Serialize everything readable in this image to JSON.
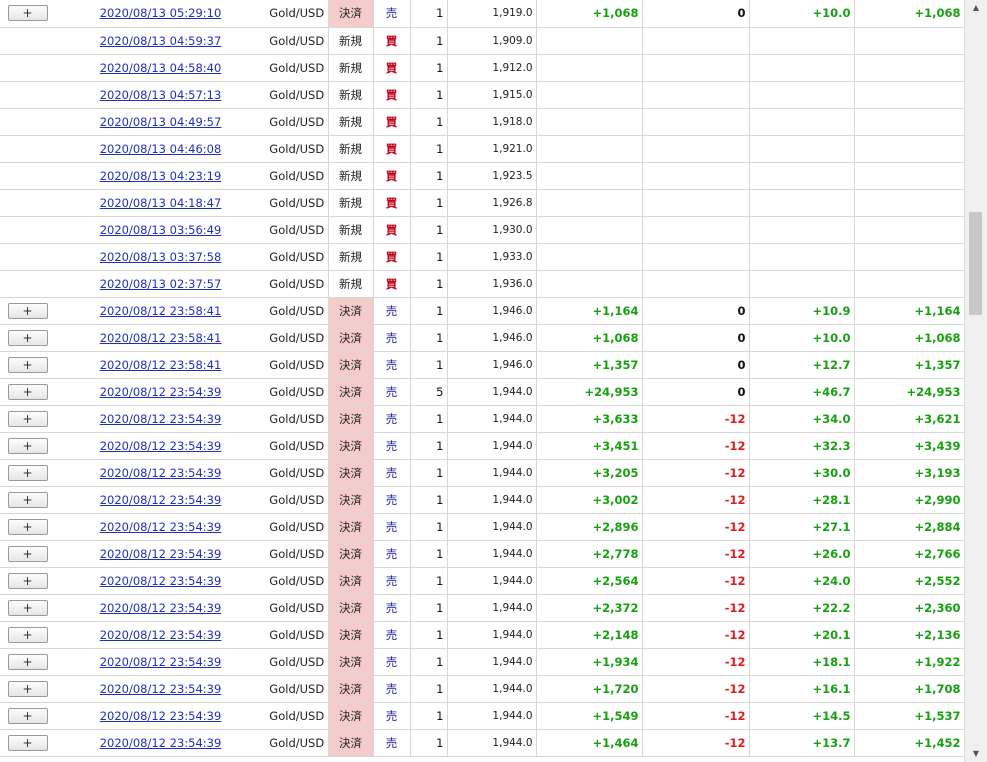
{
  "rows": [
    {
      "btn": "+",
      "time": "2020/08/13 05:29:10",
      "symbol": "Gold/USD",
      "kind": "決済",
      "side": "売",
      "qty": "1",
      "price": "1,919.0",
      "pl": "+1,068",
      "swap": "0",
      "pips": "+10.0",
      "total": "+1,068"
    },
    {
      "btn": "",
      "time": "2020/08/13 04:59:37",
      "symbol": "Gold/USD",
      "kind": "新規",
      "side": "買",
      "qty": "1",
      "price": "1,909.0",
      "pl": "",
      "swap": "",
      "pips": "",
      "total": ""
    },
    {
      "btn": "",
      "time": "2020/08/13 04:58:40",
      "symbol": "Gold/USD",
      "kind": "新規",
      "side": "買",
      "qty": "1",
      "price": "1,912.0",
      "pl": "",
      "swap": "",
      "pips": "",
      "total": ""
    },
    {
      "btn": "",
      "time": "2020/08/13 04:57:13",
      "symbol": "Gold/USD",
      "kind": "新規",
      "side": "買",
      "qty": "1",
      "price": "1,915.0",
      "pl": "",
      "swap": "",
      "pips": "",
      "total": ""
    },
    {
      "btn": "",
      "time": "2020/08/13 04:49:57",
      "symbol": "Gold/USD",
      "kind": "新規",
      "side": "買",
      "qty": "1",
      "price": "1,918.0",
      "pl": "",
      "swap": "",
      "pips": "",
      "total": ""
    },
    {
      "btn": "",
      "time": "2020/08/13 04:46:08",
      "symbol": "Gold/USD",
      "kind": "新規",
      "side": "買",
      "qty": "1",
      "price": "1,921.0",
      "pl": "",
      "swap": "",
      "pips": "",
      "total": ""
    },
    {
      "btn": "",
      "time": "2020/08/13 04:23:19",
      "symbol": "Gold/USD",
      "kind": "新規",
      "side": "買",
      "qty": "1",
      "price": "1,923.5",
      "pl": "",
      "swap": "",
      "pips": "",
      "total": ""
    },
    {
      "btn": "",
      "time": "2020/08/13 04:18:47",
      "symbol": "Gold/USD",
      "kind": "新規",
      "side": "買",
      "qty": "1",
      "price": "1,926.8",
      "pl": "",
      "swap": "",
      "pips": "",
      "total": ""
    },
    {
      "btn": "",
      "time": "2020/08/13 03:56:49",
      "symbol": "Gold/USD",
      "kind": "新規",
      "side": "買",
      "qty": "1",
      "price": "1,930.0",
      "pl": "",
      "swap": "",
      "pips": "",
      "total": ""
    },
    {
      "btn": "",
      "time": "2020/08/13 03:37:58",
      "symbol": "Gold/USD",
      "kind": "新規",
      "side": "買",
      "qty": "1",
      "price": "1,933.0",
      "pl": "",
      "swap": "",
      "pips": "",
      "total": ""
    },
    {
      "btn": "",
      "time": "2020/08/13 02:37:57",
      "symbol": "Gold/USD",
      "kind": "新規",
      "side": "買",
      "qty": "1",
      "price": "1,936.0",
      "pl": "",
      "swap": "",
      "pips": "",
      "total": ""
    },
    {
      "btn": "+",
      "time": "2020/08/12 23:58:41",
      "symbol": "Gold/USD",
      "kind": "決済",
      "side": "売",
      "qty": "1",
      "price": "1,946.0",
      "pl": "+1,164",
      "swap": "0",
      "pips": "+10.9",
      "total": "+1,164"
    },
    {
      "btn": "+",
      "time": "2020/08/12 23:58:41",
      "symbol": "Gold/USD",
      "kind": "決済",
      "side": "売",
      "qty": "1",
      "price": "1,946.0",
      "pl": "+1,068",
      "swap": "0",
      "pips": "+10.0",
      "total": "+1,068"
    },
    {
      "btn": "+",
      "time": "2020/08/12 23:58:41",
      "symbol": "Gold/USD",
      "kind": "決済",
      "side": "売",
      "qty": "1",
      "price": "1,946.0",
      "pl": "+1,357",
      "swap": "0",
      "pips": "+12.7",
      "total": "+1,357"
    },
    {
      "btn": "+",
      "time": "2020/08/12 23:54:39",
      "symbol": "Gold/USD",
      "kind": "決済",
      "side": "売",
      "qty": "5",
      "price": "1,944.0",
      "pl": "+24,953",
      "swap": "0",
      "pips": "+46.7",
      "total": "+24,953"
    },
    {
      "btn": "+",
      "time": "2020/08/12 23:54:39",
      "symbol": "Gold/USD",
      "kind": "決済",
      "side": "売",
      "qty": "1",
      "price": "1,944.0",
      "pl": "+3,633",
      "swap": "-12",
      "pips": "+34.0",
      "total": "+3,621"
    },
    {
      "btn": "+",
      "time": "2020/08/12 23:54:39",
      "symbol": "Gold/USD",
      "kind": "決済",
      "side": "売",
      "qty": "1",
      "price": "1,944.0",
      "pl": "+3,451",
      "swap": "-12",
      "pips": "+32.3",
      "total": "+3,439"
    },
    {
      "btn": "+",
      "time": "2020/08/12 23:54:39",
      "symbol": "Gold/USD",
      "kind": "決済",
      "side": "売",
      "qty": "1",
      "price": "1,944.0",
      "pl": "+3,205",
      "swap": "-12",
      "pips": "+30.0",
      "total": "+3,193"
    },
    {
      "btn": "+",
      "time": "2020/08/12 23:54:39",
      "symbol": "Gold/USD",
      "kind": "決済",
      "side": "売",
      "qty": "1",
      "price": "1,944.0",
      "pl": "+3,002",
      "swap": "-12",
      "pips": "+28.1",
      "total": "+2,990"
    },
    {
      "btn": "+",
      "time": "2020/08/12 23:54:39",
      "symbol": "Gold/USD",
      "kind": "決済",
      "side": "売",
      "qty": "1",
      "price": "1,944.0",
      "pl": "+2,896",
      "swap": "-12",
      "pips": "+27.1",
      "total": "+2,884"
    },
    {
      "btn": "+",
      "time": "2020/08/12 23:54:39",
      "symbol": "Gold/USD",
      "kind": "決済",
      "side": "売",
      "qty": "1",
      "price": "1,944.0",
      "pl": "+2,778",
      "swap": "-12",
      "pips": "+26.0",
      "total": "+2,766"
    },
    {
      "btn": "+",
      "time": "2020/08/12 23:54:39",
      "symbol": "Gold/USD",
      "kind": "決済",
      "side": "売",
      "qty": "1",
      "price": "1,944.0",
      "pl": "+2,564",
      "swap": "-12",
      "pips": "+24.0",
      "total": "+2,552"
    },
    {
      "btn": "+",
      "time": "2020/08/12 23:54:39",
      "symbol": "Gold/USD",
      "kind": "決済",
      "side": "売",
      "qty": "1",
      "price": "1,944.0",
      "pl": "+2,372",
      "swap": "-12",
      "pips": "+22.2",
      "total": "+2,360"
    },
    {
      "btn": "+",
      "time": "2020/08/12 23:54:39",
      "symbol": "Gold/USD",
      "kind": "決済",
      "side": "売",
      "qty": "1",
      "price": "1,944.0",
      "pl": "+2,148",
      "swap": "-12",
      "pips": "+20.1",
      "total": "+2,136"
    },
    {
      "btn": "+",
      "time": "2020/08/12 23:54:39",
      "symbol": "Gold/USD",
      "kind": "決済",
      "side": "売",
      "qty": "1",
      "price": "1,944.0",
      "pl": "+1,934",
      "swap": "-12",
      "pips": "+18.1",
      "total": "+1,922"
    },
    {
      "btn": "+",
      "time": "2020/08/12 23:54:39",
      "symbol": "Gold/USD",
      "kind": "決済",
      "side": "売",
      "qty": "1",
      "price": "1,944.0",
      "pl": "+1,720",
      "swap": "-12",
      "pips": "+16.1",
      "total": "+1,708"
    },
    {
      "btn": "+",
      "time": "2020/08/12 23:54:39",
      "symbol": "Gold/USD",
      "kind": "決済",
      "side": "売",
      "qty": "1",
      "price": "1,944.0",
      "pl": "+1,549",
      "swap": "-12",
      "pips": "+14.5",
      "total": "+1,537"
    },
    {
      "btn": "+",
      "time": "2020/08/12 23:54:39",
      "symbol": "Gold/USD",
      "kind": "決済",
      "side": "売",
      "qty": "1",
      "price": "1,944.0",
      "pl": "+1,464",
      "swap": "-12",
      "pips": "+13.7",
      "total": "+1,452"
    }
  ],
  "colors": {
    "positive": "#17a010",
    "negative": "#e01c1c",
    "buy": "#c0001a",
    "sell": "#1a1a9e",
    "settle_bg": "#f4cccc",
    "link": "#1f2fbf"
  },
  "scrollbar": {
    "up_icon": "scroll-up-arrow-icon",
    "down_icon": "scroll-down-arrow-icon"
  }
}
